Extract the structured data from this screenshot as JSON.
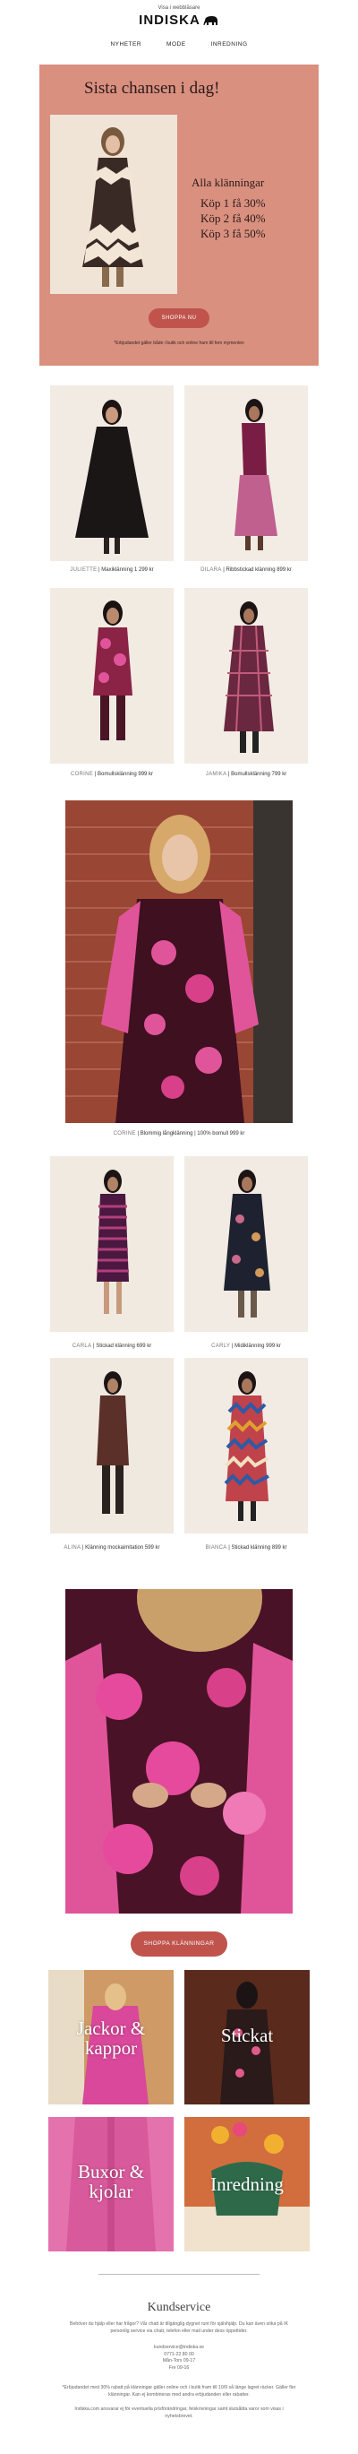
{
  "header": {
    "top_link": "Visa i webbläsare",
    "logo": "INDISKA",
    "nav": [
      "NYHETER",
      "MODE",
      "INREDNING"
    ]
  },
  "hero": {
    "title": "Sista chansen i dag!",
    "offer_heading": "Alla klänningar",
    "offer_lines": [
      "Köp 1 få 30%",
      "Köp 2 få 40%",
      "Köp 3 få 50%"
    ],
    "button": "SHOPPA NU",
    "note": "*Erbjudandet gäller både i butik och online fram till fem mymenlen",
    "bg_color": "#d9907f",
    "button_color": "#c0544d"
  },
  "products": [
    {
      "name": "JULIETTE",
      "desc": "Maxiklänning 1 299 kr"
    },
    {
      "name": "DILARA",
      "desc": "Ribbstickad klänning 899 kr"
    },
    {
      "name": "CORINE",
      "desc": "Bomullsklänning 999 kr"
    },
    {
      "name": "JAMIKA",
      "desc": "Bomullsklänning 799 kr"
    },
    {
      "name": "CORINE",
      "desc": "Blommig långklänning | 100% bomull 999 kr"
    },
    {
      "name": "CARLA",
      "desc": "Stickad klänning 699 kr"
    },
    {
      "name": "CARLY",
      "desc": "Midiklänning 999 kr"
    },
    {
      "name": "ALINA",
      "desc": "Klänning mockaimitation 599 kr"
    },
    {
      "name": "BIANCA",
      "desc": "Stickad klänning 899 kr"
    }
  ],
  "shop_button": "SHOPPA KLÄNNINGAR",
  "categories": [
    {
      "line1": "Jackor &",
      "line2": "kappor"
    },
    {
      "line1": "Stickat",
      "line2": ""
    },
    {
      "line1": "Buxor &",
      "line2": "kjolar"
    },
    {
      "line1": "Inredning",
      "line2": ""
    }
  ],
  "footer": {
    "title": "Kundservice",
    "intro": [
      "Behöver du hjälp eller har frågor? Vår chatt är tillgänglig dygnet runt för självhjälp. Du kan även söka på IK",
      "personlig service via chatt, telefon eller mail under dess öppettider."
    ],
    "contact": [
      "kundservice@indiska.se",
      "0771-22 80 00",
      "Mån-Tors 09-17",
      "Fre 09-16"
    ],
    "disclaimer": [
      "*Erbjudandet med 30% rabatt på klänningar gäller online och i butik fram till 10/9 så länge lagret räcker. Gäller fler",
      "klänningar. Kan ej kombineras med andra erbjudanden eller rabatter."
    ],
    "unsubscribe": [
      "Indiska.com ansvarar ej för eventuella prisförändringar, felskrivningar samt slutsålda varor som visas i",
      "nyhetsbrevet."
    ]
  }
}
